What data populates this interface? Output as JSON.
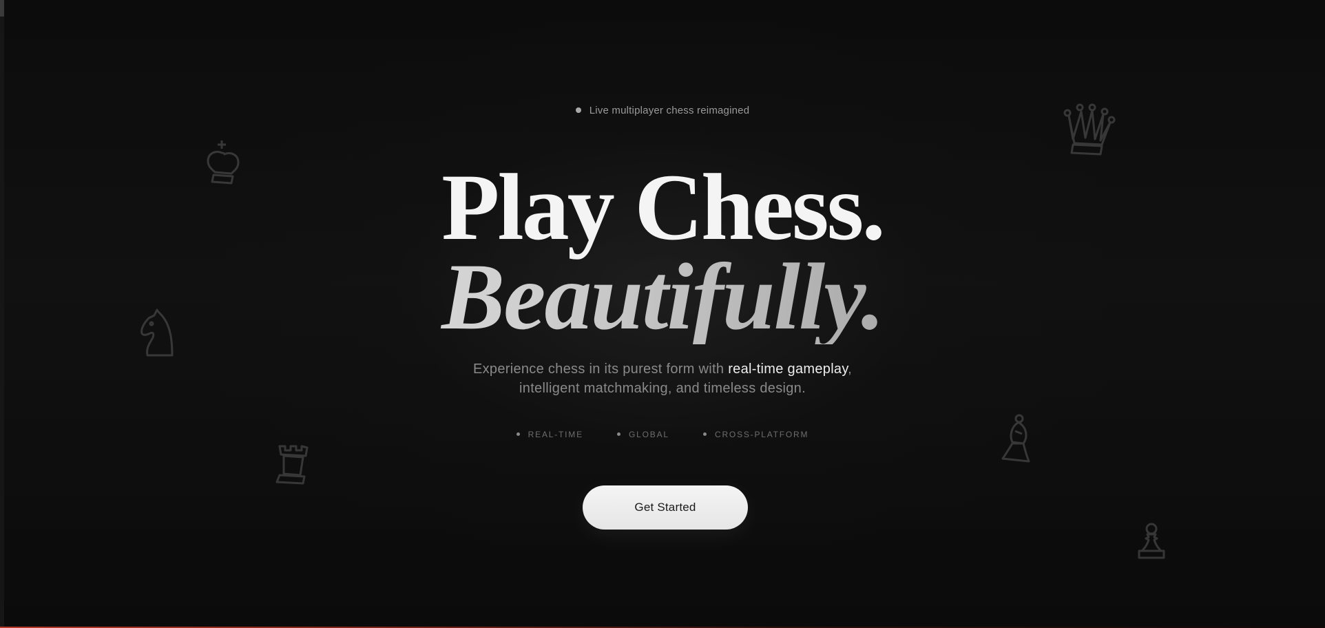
{
  "hero": {
    "tagline": "Live multiplayer chess reimagined",
    "headline_line1": "Play Chess.",
    "headline_line2": "Beautifully.",
    "subtitle": {
      "before": "Experience chess in its purest form with ",
      "highlight": "real-time gameplay",
      "after_line1": ",",
      "line2": "intelligent matchmaking, and timeless design."
    },
    "features": [
      "REAL-TIME",
      "GLOBAL",
      "CROSS-PLATFORM"
    ],
    "cta_label": "Get Started"
  },
  "decor": {
    "pieces": [
      "king-icon",
      "queen-icon",
      "knight-icon",
      "rook-icon",
      "bishop-icon",
      "pawn-icon"
    ]
  },
  "colors": {
    "background": "#0a0a0a",
    "headline": "#f4f4f4",
    "muted_text": "#8a8a8a",
    "button_bg": "#f0f0f0",
    "accent_line": "#b83a2a"
  }
}
